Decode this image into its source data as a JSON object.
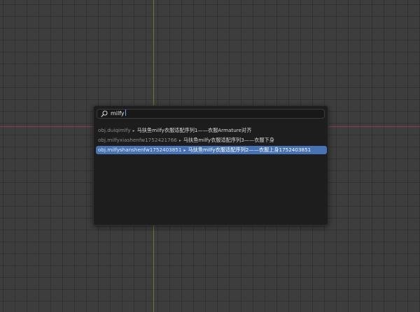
{
  "search": {
    "query": "milfy"
  },
  "results": [
    {
      "prefix": "obj.duiqimlfy",
      "label": "马扶鱼milfy衣服适配序列1——衣服Armature对齐",
      "selected": false
    },
    {
      "prefix": "obj.milfyxiashenfw1752421766",
      "label": "马扶鱼milfy衣服适配序列3——衣服下身",
      "selected": false
    },
    {
      "prefix": "obj.milfyshanshenfw1752403851",
      "label": "马扶鱼milfy衣服适配序列2——衣服上身1752403851",
      "selected": true
    }
  ],
  "icons": {
    "search": "search-icon",
    "separator": "triangle-right-icon"
  },
  "colors": {
    "viewport_bg": "#3d3d3d",
    "popup_bg": "#1d1d1d",
    "selection": "#4772b3",
    "x_axis": "#8a3d47",
    "y_axis": "#5f7f2e"
  }
}
